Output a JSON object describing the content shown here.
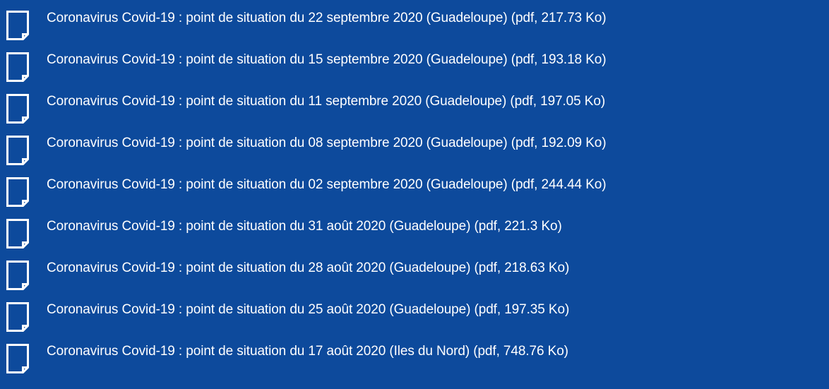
{
  "colors": {
    "background": "#0d4a9c",
    "text": "#ffffff",
    "icon": "#ffffff"
  },
  "documents": [
    {
      "icon": "document-icon",
      "label": "Coronavirus Covid-19 : point de situation du 22 septembre 2020 (Guadeloupe) (pdf, 217.73 Ko)"
    },
    {
      "icon": "document-icon",
      "label": "Coronavirus Covid-19 : point de situation du 15 septembre 2020 (Guadeloupe) (pdf, 193.18 Ko)"
    },
    {
      "icon": "document-icon",
      "label": "Coronavirus Covid-19 : point de situation du 11 septembre 2020 (Guadeloupe) (pdf, 197.05 Ko)"
    },
    {
      "icon": "document-icon",
      "label": "Coronavirus Covid-19 : point de situation du 08 septembre 2020 (Guadeloupe) (pdf, 192.09 Ko)"
    },
    {
      "icon": "document-icon",
      "label": "Coronavirus Covid-19 : point de situation du 02 septembre 2020 (Guadeloupe) (pdf, 244.44 Ko)"
    },
    {
      "icon": "document-icon",
      "label": "Coronavirus Covid-19 : point de situation du 31 août 2020 (Guadeloupe) (pdf, 221.3 Ko)"
    },
    {
      "icon": "document-icon",
      "label": "Coronavirus Covid-19 : point de situation du 28 août 2020 (Guadeloupe) (pdf, 218.63 Ko)"
    },
    {
      "icon": "document-icon",
      "label": "Coronavirus Covid-19 : point de situation du 25 août 2020 (Guadeloupe) (pdf, 197.35 Ko)"
    },
    {
      "icon": "document-icon",
      "label": "Coronavirus Covid-19 : point de situation du 17 août 2020 (Iles du Nord) (pdf, 748.76 Ko)"
    }
  ]
}
